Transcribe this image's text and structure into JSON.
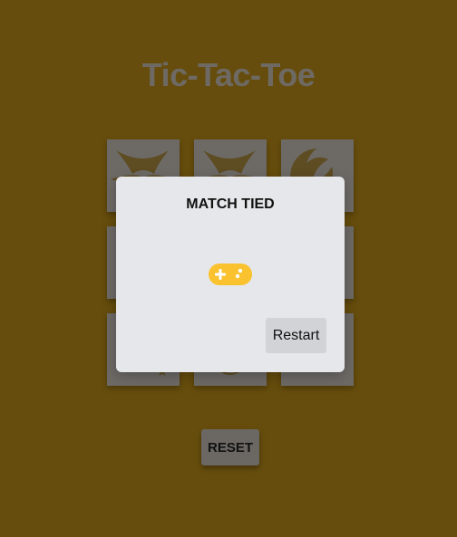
{
  "app": {
    "title": "Tic-Tac-Toe"
  },
  "board": {
    "cells": [
      {
        "index": 0,
        "mark": "x"
      },
      {
        "index": 1,
        "mark": "x"
      },
      {
        "index": 2,
        "mark": "o"
      },
      {
        "index": 3,
        "mark": ""
      },
      {
        "index": 4,
        "mark": ""
      },
      {
        "index": 5,
        "mark": ""
      },
      {
        "index": 6,
        "mark": "x"
      },
      {
        "index": 7,
        "mark": "o"
      },
      {
        "index": 8,
        "mark": "x"
      }
    ]
  },
  "controls": {
    "reset_label": "RESET"
  },
  "modal": {
    "title": "MATCH TIED",
    "icon": "gamepad-icon",
    "restart_label": "Restart"
  },
  "colors": {
    "background": "#664d0d",
    "title": "#6e6a63",
    "cell": "#6d6a66",
    "mark": "#5a4a25",
    "modal": "#e6e7ea",
    "icon": "#f9c22e"
  }
}
